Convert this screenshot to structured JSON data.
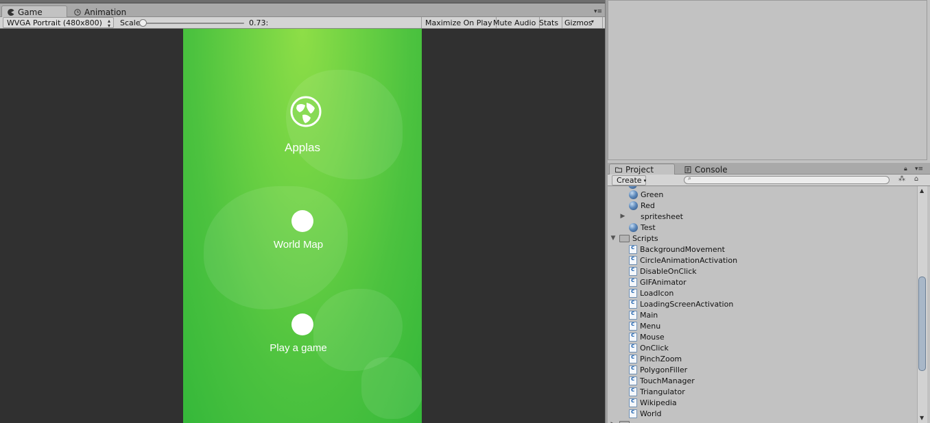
{
  "game_panel": {
    "tabs": [
      {
        "label": "Game",
        "icon": "pacman-icon",
        "active": true
      },
      {
        "label": "Animation",
        "icon": "clock-icon",
        "active": false
      }
    ],
    "toolbar": {
      "aspect": "WVGA Portrait (480x800)",
      "scale_label": "Scale",
      "scale_value": "0.73:",
      "maximize_on_play": "Maximize On Play",
      "mute_audio": "Mute Audio",
      "stats": "Stats",
      "gizmos": "Gizmos"
    },
    "screen": {
      "title": "Applas",
      "menu": [
        {
          "label": "World Map"
        },
        {
          "label": "Play a game"
        }
      ],
      "colors": {
        "top": "#8ede47",
        "bottom": "#35b83a"
      }
    }
  },
  "project_panel": {
    "tabs": [
      {
        "label": "Project",
        "icon": "folder-icon",
        "active": true
      },
      {
        "label": "Console",
        "icon": "console-icon",
        "active": false
      }
    ],
    "create_label": "Create",
    "search_placeholder": "",
    "tree": [
      {
        "label": "Green",
        "type": "material"
      },
      {
        "label": "Red",
        "type": "material"
      },
      {
        "label": "spritesheet",
        "type": "collapsed"
      },
      {
        "label": "Test",
        "type": "material"
      },
      {
        "label": "Scripts",
        "type": "folder"
      },
      {
        "label": "BackgroundMovement",
        "type": "script"
      },
      {
        "label": "CircleAnimationActivation",
        "type": "script"
      },
      {
        "label": "DisableOnClick",
        "type": "script"
      },
      {
        "label": "GIFAnimator",
        "type": "script"
      },
      {
        "label": "LoadIcon",
        "type": "script"
      },
      {
        "label": "LoadingScreenActivation",
        "type": "script"
      },
      {
        "label": "Main",
        "type": "script"
      },
      {
        "label": "Menu",
        "type": "script"
      },
      {
        "label": "Mouse",
        "type": "script"
      },
      {
        "label": "OnClick",
        "type": "script"
      },
      {
        "label": "PinchZoom",
        "type": "script"
      },
      {
        "label": "PolygonFiller",
        "type": "script"
      },
      {
        "label": "TouchManager",
        "type": "script"
      },
      {
        "label": "Triangulator",
        "type": "script"
      },
      {
        "label": "Wikipedia",
        "type": "script"
      },
      {
        "label": "World",
        "type": "script"
      }
    ]
  }
}
